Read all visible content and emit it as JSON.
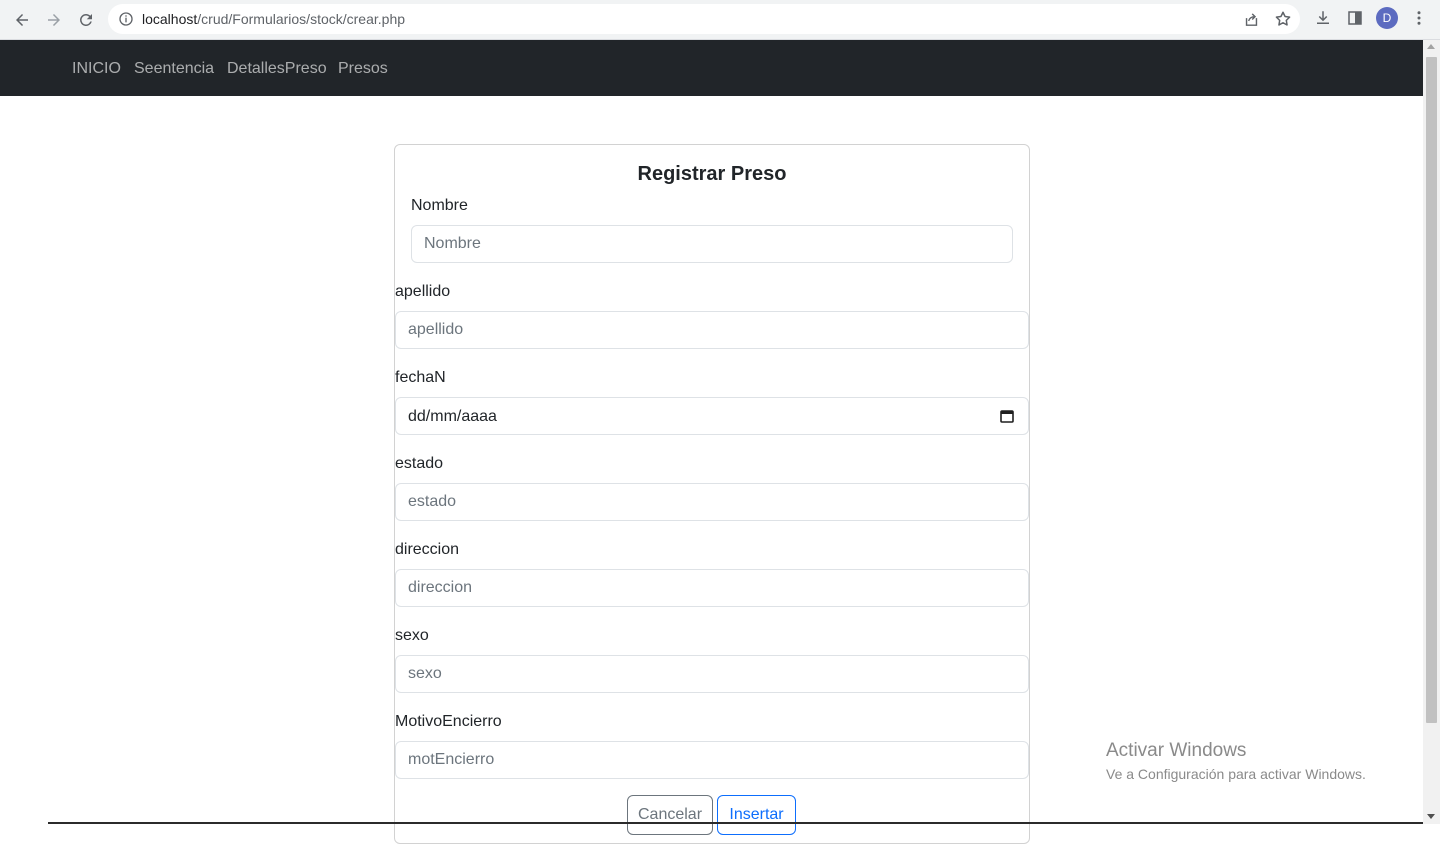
{
  "browser": {
    "url_host": "localhost",
    "url_path": "/crud/Formularios/stock/crear.php",
    "profile_initial": "D"
  },
  "navbar": {
    "links": [
      "INICIO",
      "Seentencia",
      "DetallesPreso",
      "Presos"
    ]
  },
  "form": {
    "title": "Registrar Preso",
    "nombre_label": "Nombre",
    "nombre_placeholder": "Nombre",
    "apellido_label": "apellido",
    "apellido_placeholder": "apellido",
    "fecha_label": "fechaN",
    "fecha_placeholder": "dd/mm/aaaa",
    "estado_label": "estado",
    "estado_placeholder": "estado",
    "direccion_label": "direccion",
    "direccion_placeholder": "direccion",
    "sexo_label": "sexo",
    "sexo_placeholder": "sexo",
    "motivo_label": "MotivoEncierro",
    "motivo_placeholder": "motEncierro",
    "cancel_label": "Cancelar",
    "submit_label": "Insertar"
  },
  "watermark": {
    "title": "Activar Windows",
    "subtitle": "Ve a Configuración para activar Windows."
  }
}
